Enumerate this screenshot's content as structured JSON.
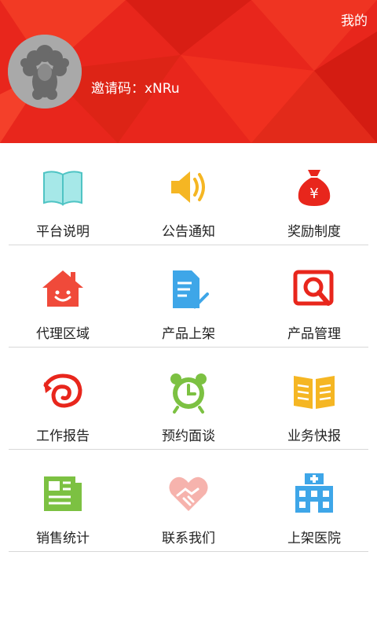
{
  "header": {
    "title": "我的",
    "invite_text": "邀请码：xNRu",
    "bg_color": "#e8261c"
  },
  "menu": {
    "rows": [
      [
        {
          "label": "平台说明",
          "icon": "book-icon",
          "color": "#7fd8d8"
        },
        {
          "label": "公告通知",
          "icon": "speaker-icon",
          "color": "#f5b623"
        },
        {
          "label": "奖励制度",
          "icon": "money-bag-icon",
          "color": "#e8261c"
        }
      ],
      [
        {
          "label": "代理区域",
          "icon": "house-smile-icon",
          "color": "#f04a3a"
        },
        {
          "label": "产品上架",
          "icon": "document-check-icon",
          "color": "#3ea6e8"
        },
        {
          "label": "产品管理",
          "icon": "search-document-icon",
          "color": "#e8261c"
        }
      ],
      [
        {
          "label": "工作报告",
          "icon": "swirl-icon",
          "color": "#e8261c"
        },
        {
          "label": "预约面谈",
          "icon": "alarm-clock-icon",
          "color": "#7cc142"
        },
        {
          "label": "业务快报",
          "icon": "open-book-icon",
          "color": "#f5b623"
        }
      ],
      [
        {
          "label": "销售统计",
          "icon": "newspaper-icon",
          "color": "#7cc142"
        },
        {
          "label": "联系我们",
          "icon": "heart-handshake-icon",
          "color": "#f6b3ad"
        },
        {
          "label": "上架医院",
          "icon": "hospital-icon",
          "color": "#3ea6e8"
        }
      ]
    ]
  }
}
